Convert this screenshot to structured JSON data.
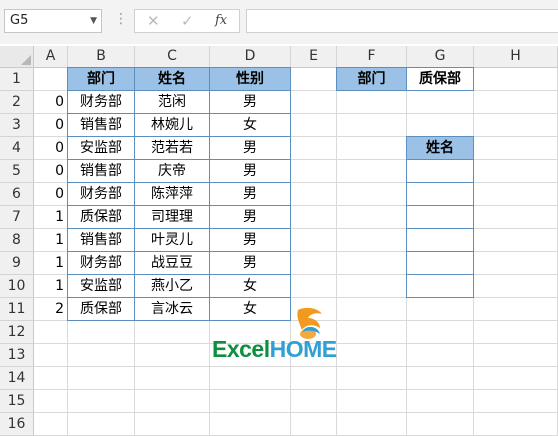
{
  "formula_bar": {
    "name_box": "G5",
    "cancel_icon": "x-icon",
    "confirm_icon": "check-icon",
    "function_label": "fx",
    "formula": ""
  },
  "columns": [
    "A",
    "B",
    "C",
    "D",
    "E",
    "F",
    "G",
    "H"
  ],
  "rows": [
    "1",
    "2",
    "3",
    "4",
    "5",
    "6",
    "7",
    "8",
    "9",
    "10",
    "11",
    "12",
    "13",
    "14",
    "15",
    "16"
  ],
  "table": {
    "headers": {
      "dept": "部门",
      "name": "姓名",
      "gender": "性别"
    },
    "rows": [
      {
        "a": "0",
        "dept": "财务部",
        "name": "范闲",
        "gender": "男"
      },
      {
        "a": "0",
        "dept": "销售部",
        "name": "林婉儿",
        "gender": "女"
      },
      {
        "a": "0",
        "dept": "安监部",
        "name": "范若若",
        "gender": "男"
      },
      {
        "a": "0",
        "dept": "销售部",
        "name": "庆帝",
        "gender": "男"
      },
      {
        "a": "0",
        "dept": "财务部",
        "name": "陈萍萍",
        "gender": "男"
      },
      {
        "a": "1",
        "dept": "质保部",
        "name": "司理理",
        "gender": "男"
      },
      {
        "a": "1",
        "dept": "销售部",
        "name": "叶灵儿",
        "gender": "男"
      },
      {
        "a": "1",
        "dept": "财务部",
        "name": "战豆豆",
        "gender": "男"
      },
      {
        "a": "1",
        "dept": "安监部",
        "name": "燕小乙",
        "gender": "女"
      },
      {
        "a": "2",
        "dept": "质保部",
        "name": "言冰云",
        "gender": "女"
      }
    ]
  },
  "lookup": {
    "dept_label": "部门",
    "dept_value": "质保部",
    "name_header": "姓名",
    "results": [
      "",
      "",
      "",
      "",
      "",
      ""
    ]
  },
  "watermark": {
    "part1": "Excel",
    "part2": "HOME"
  },
  "colors": {
    "header_fill": "#9bc2e6",
    "table_border": "#5b8fbf"
  }
}
